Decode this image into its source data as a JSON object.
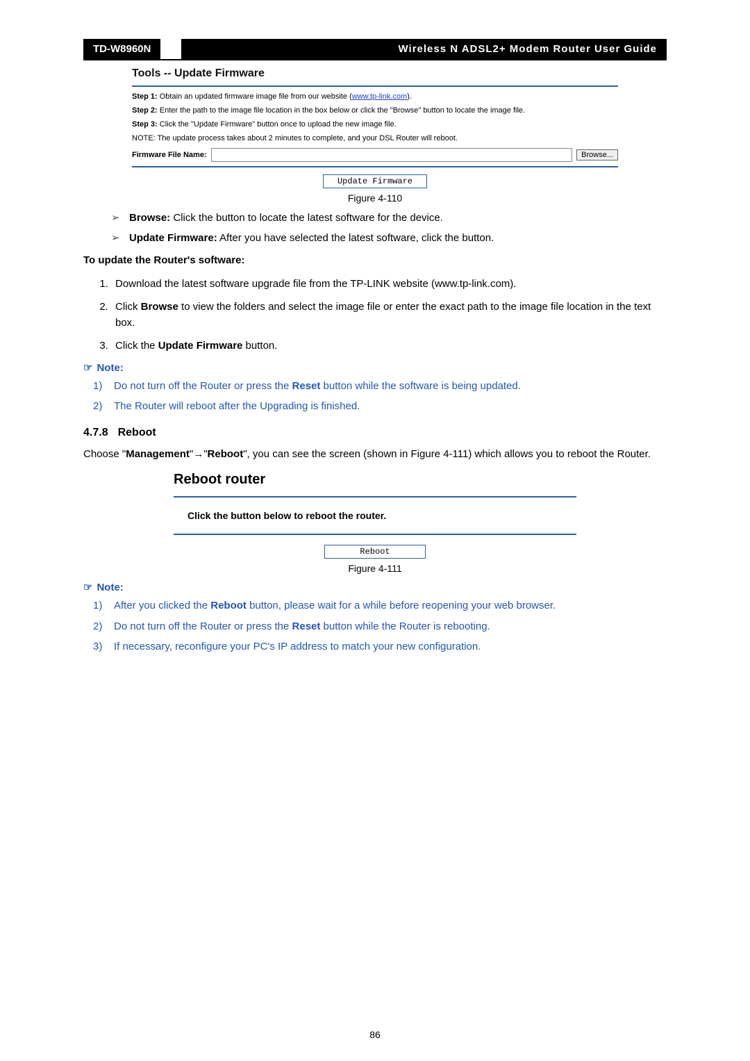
{
  "header": {
    "model": "TD-W8960N",
    "title": "Wireless  N  ADSL2+  Modem  Router  User  Guide"
  },
  "fw_panel": {
    "title": "Tools -- Update Firmware",
    "step1_label": "Step 1:",
    "step1_text": " Obtain an updated firmware image file from our website (",
    "step1_link": "www.tp-link.com",
    "step1_tail": ").",
    "step2_label": "Step 2:",
    "step2_text": " Enter the path to the image file location in the box below or click the \"Browse\" button to locate the image file.",
    "step3_label": "Step 3:",
    "step3_text": " Click the \"Update Firmware\" button once to upload the new image file.",
    "note": "NOTE: The update process takes about 2 minutes to complete, and your DSL Router will reboot.",
    "file_label": "Firmware File Name:",
    "file_value": "",
    "browse_label": "Browse...",
    "update_label": "Update Firmware"
  },
  "fig110": "Figure 4-110",
  "bullets": {
    "b1_bold": "Browse:",
    "b1_text": " Click the button to locate the latest software for the device.",
    "b2_bold": "Update Firmware:",
    "b2_text": " After you have selected the latest software, click the button."
  },
  "update_heading": "To update the Router's software:",
  "steps": {
    "s1": "Download the latest software upgrade file from the TP-LINK website (www.tp-link.com).",
    "s2_a": "Click ",
    "s2_b": "Browse",
    "s2_c": " to view the folders and select the image file or enter the exact path to the image file location in the text box.",
    "s3_a": "Click the ",
    "s3_b": "Update Firmware",
    "s3_c": " button."
  },
  "note_label": "Note:",
  "note1_items": {
    "n1_a": "Do not turn off the Router or press the ",
    "n1_b": "Reset",
    "n1_c": " button while the software is being updated.",
    "n2": "The Router will reboot after the Upgrading is finished."
  },
  "section": {
    "num": "4.7.8",
    "title": "Reboot"
  },
  "reboot_para": {
    "a": "Choose \"",
    "mgmt": "Management",
    "arrow": "\"→\"",
    "reboot": "Reboot",
    "b": "\", you can see the screen (shown in Figure 4-111) which allows you to reboot the Router."
  },
  "reboot_panel": {
    "title": "Reboot router",
    "instr": "Click the button below to reboot the router.",
    "btn": "Reboot"
  },
  "fig111": "Figure 4-111",
  "note2_items": {
    "n1_a": "After you clicked the ",
    "n1_b": "Reboot",
    "n1_c": " button, please wait for a while before reopening your web browser.",
    "n2_a": "Do not turn off the Router or press the ",
    "n2_b": "Reset",
    "n2_c": " button while the Router is rebooting.",
    "n3": "If necessary, reconfigure your PC's IP address to match your new configuration."
  },
  "page_num": "86"
}
